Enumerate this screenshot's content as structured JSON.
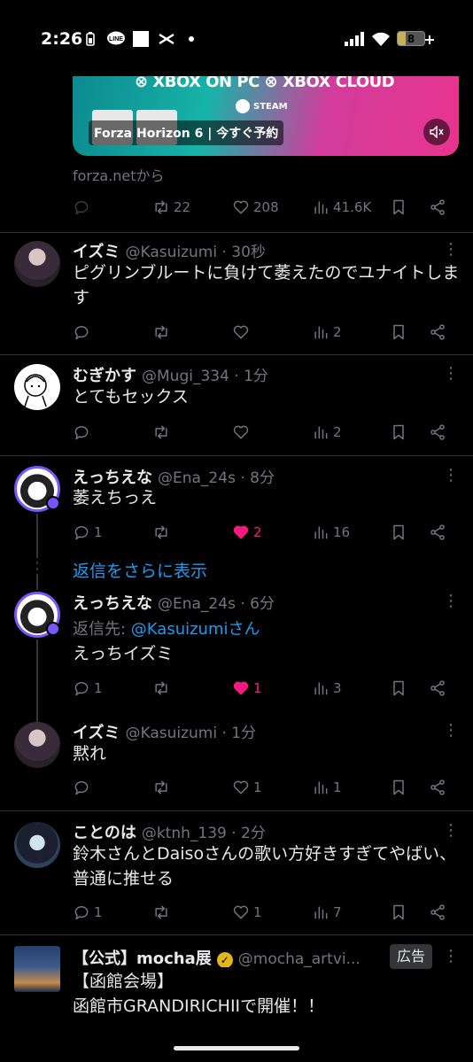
{
  "status": {
    "time": "2:26",
    "battery": "8"
  },
  "ad": {
    "xbox_text": "⊗ XBOX ON PC    ⊗ XBOX CLOUD",
    "steam_text": "STEAM",
    "caption": "Forza Horizon 6 | 今すぐ予約",
    "source": "forza.netから"
  },
  "top_actions": {
    "retweets": "22",
    "likes": "208",
    "views": "41.6K"
  },
  "posts": [
    {
      "name": "イズミ",
      "meta": "@Kasuizumi · 30秒",
      "text": "ピグリンブルートに負けて萎えたのでユナイトします",
      "replies": "",
      "retweets": "",
      "likes": "",
      "views": "2"
    },
    {
      "name": "むぎかす",
      "meta": "@Mugi_334 · 1分",
      "text": "とてもセックス",
      "replies": "",
      "retweets": "",
      "likes": "",
      "views": "2"
    },
    {
      "name": "えっちえな",
      "meta": "@Ena_24s · 8分",
      "text": "萎えちっえ",
      "replies": "1",
      "retweets": "",
      "likes": "2",
      "views": "16"
    },
    {
      "name": "えっちえな",
      "meta": "@Ena_24s · 6分",
      "reply_label": "返信先: ",
      "reply_handle": "@Kasuizumiさん",
      "text": "えっちイズミ",
      "replies": "1",
      "retweets": "",
      "likes": "1",
      "views": "3"
    },
    {
      "name": "イズミ",
      "meta": "@Kasuizumi · 1分",
      "text": "黙れ",
      "replies": "",
      "retweets": "",
      "likes": "1",
      "views": "1"
    },
    {
      "name": "ことのは",
      "meta": "@ktnh_139 · 2分",
      "text": "鈴木さんとDaisoさんの歌い方好きすぎてやばい、普通に推せる",
      "replies": "1",
      "retweets": "",
      "likes": "1",
      "views": "7"
    },
    {
      "name": "【公式】mocha展",
      "meta": "@mocha_artvi...",
      "text": "【函館会場】\n函館市GRANDIRICHIIで開催！！",
      "ad_label": "広告"
    }
  ],
  "show_more": "返信をさらに表示",
  "colors": {
    "accent": "#1d9bf0",
    "like": "#f91880",
    "muted": "#71767b",
    "divider": "#2f3336"
  }
}
